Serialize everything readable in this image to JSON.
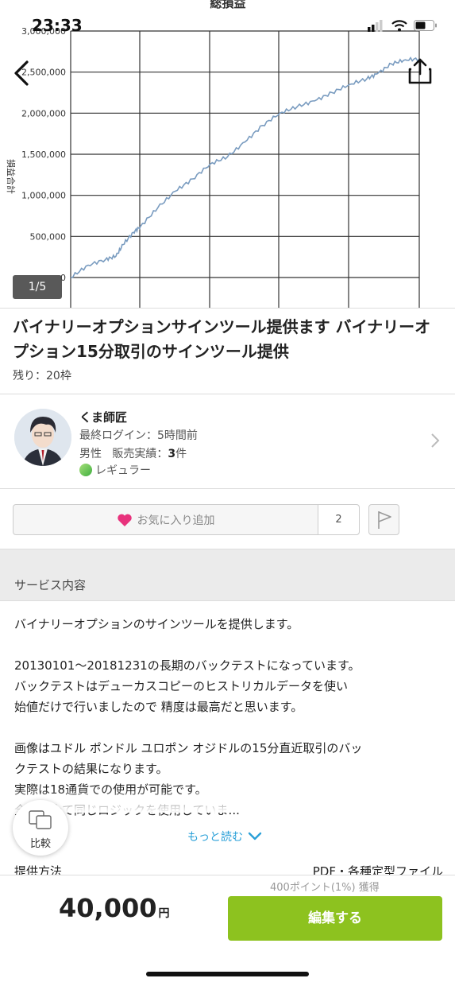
{
  "status_bar": {
    "time": "23:33"
  },
  "hero": {
    "page_indicator": "1/5"
  },
  "chart_data": {
    "type": "line",
    "title": "総損益",
    "ylabel": "損益合計",
    "ylim": [
      0,
      3000000
    ],
    "yticks": [
      0,
      500000,
      1000000,
      1500000,
      2000000,
      2500000,
      3000000
    ],
    "ytick_labels": [
      "0",
      "500,000",
      "1,000,000",
      "1,500,000",
      "2,000,000",
      "2,500,000",
      "3,000,000"
    ],
    "x": [
      0,
      0.05,
      0.1,
      0.13,
      0.15,
      0.18,
      0.2,
      0.25,
      0.3,
      0.35,
      0.4,
      0.45,
      0.5,
      0.55,
      0.6,
      0.65,
      0.7,
      0.75,
      0.8,
      0.85,
      0.88,
      0.92,
      0.96,
      1.0
    ],
    "series": [
      {
        "values": [
          0,
          150000,
          220000,
          260000,
          400000,
          550000,
          620000,
          850000,
          1050000,
          1200000,
          1380000,
          1470000,
          1650000,
          1850000,
          2000000,
          2080000,
          2150000,
          2250000,
          2350000,
          2420000,
          2480000,
          2600000,
          2650000,
          2660000
        ]
      }
    ],
    "grid": true
  },
  "listing": {
    "title": "バイナリーオプションサインツール提供ます バイナリーオプション15分取引のサインツール提供",
    "remaining": "残り：20枠"
  },
  "seller": {
    "name": "くま師匠",
    "last_login": "最終ログイン：5時間前",
    "gender": "男性",
    "sales_label": "販売実績：",
    "sales_count": "3",
    "sales_unit": "件",
    "rank": "レギュラー"
  },
  "favorite": {
    "label": "お気に入り追加",
    "count": "2"
  },
  "section": {
    "service_title": "サービス内容"
  },
  "description": {
    "lines": [
      "バイナリーオプションのサインツールを提供します。",
      "",
      "20130101〜20181231の長期のバックテストになっています。",
      "バックテストはデューカスコピーのヒストリカルデータを使い",
      "始値だけで行いましたので 精度は最高だと思います。",
      "",
      "画像はユドル ポンドル ユロポン オジドルの15分直近取引のバッ",
      "クテストの結果になります。",
      "実際は18通貨での使用が可能です。",
      "全通貨全て同じロジックを使用していま..."
    ],
    "more": "もっと読む"
  },
  "compare": {
    "label": "比較"
  },
  "delivery": {
    "label": "提供方法",
    "value": "PDF・各種定型ファイル"
  },
  "purchase": {
    "points": "400ポイント(1%) 獲得",
    "price": "40,000",
    "currency": "円",
    "button": "編集する"
  },
  "colors": {
    "accent_green": "#8dc21f",
    "link_blue": "#2aa0d8",
    "heart_pink": "#e8327c",
    "line_blue": "#7a9cc0"
  }
}
